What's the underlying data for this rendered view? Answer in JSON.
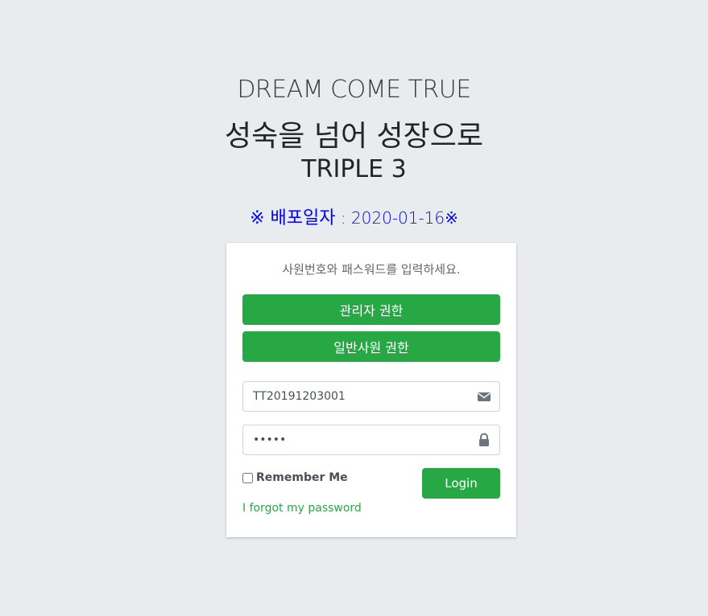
{
  "header": {
    "line1": "DREAM COME TRUE",
    "line2": "성숙을 넘어 성장으로",
    "line3": "TRIPLE 3",
    "deploy_prefix": "※ 배포일자",
    "deploy_sep": " : ",
    "deploy_date": "2020-01-16",
    "deploy_suffix": "※"
  },
  "login": {
    "message": "사원번호와 패스워드를 입력하세요.",
    "admin_button": "관리자 권한",
    "staff_button": "일반사원 권한",
    "username_value": "TT20191203001",
    "password_value": "12345",
    "remember_label": "Remember Me",
    "login_button": "Login",
    "forgot_link": "I forgot my password"
  },
  "icons": {
    "username": "envelope-icon",
    "password": "lock-icon"
  },
  "colors": {
    "background": "#e9ecef",
    "accent": "#28a745",
    "deploy_text": "#0000ff"
  }
}
